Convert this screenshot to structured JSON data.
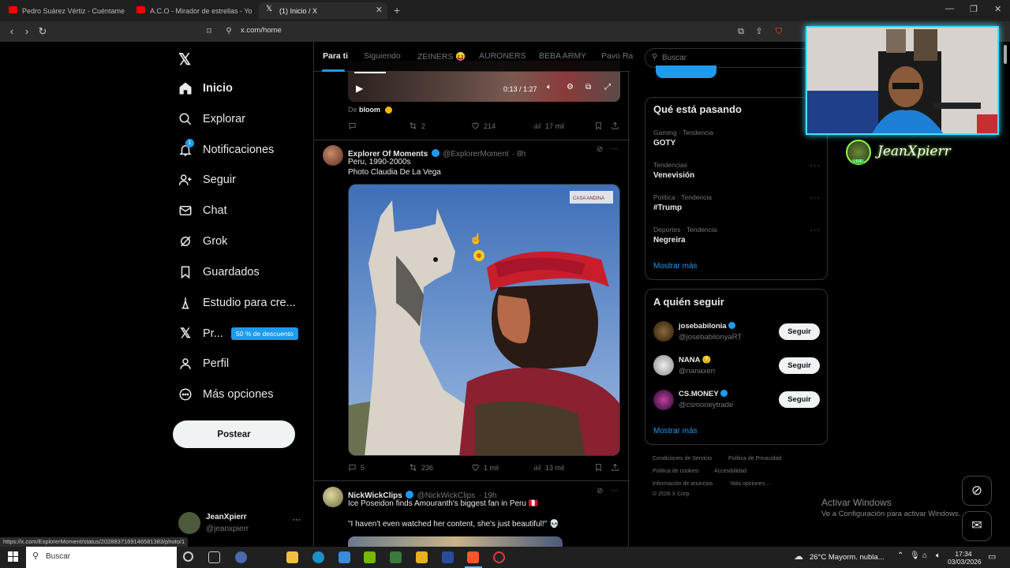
{
  "browser": {
    "tabs": [
      {
        "title": "Pedro Suárez Vértiz - Cuéntame - Yo",
        "favicon": "youtube-icon",
        "color": "#ff0000"
      },
      {
        "title": "A.C.O - Mirador de estrellas - Yo",
        "favicon": "youtube-icon",
        "color": "#ff0000"
      },
      {
        "title": "(1) Inicio / X",
        "favicon": "x-icon",
        "color": "#ffffff"
      }
    ],
    "url": "x.com/home",
    "status_url": "https://x.com/ExplorerMoment/status/2028837169146581383/photo/1"
  },
  "sidebar": {
    "items": [
      {
        "label": "Inicio",
        "icon": "home-icon"
      },
      {
        "label": "Explorar",
        "icon": "search-icon"
      },
      {
        "label": "Notificaciones",
        "icon": "bell-icon",
        "badge": "1"
      },
      {
        "label": "Seguir",
        "icon": "add-user-icon"
      },
      {
        "label": "Chat",
        "icon": "mail-icon"
      },
      {
        "label": "Grok",
        "icon": "grok-icon"
      },
      {
        "label": "Guardados",
        "icon": "bookmark-icon"
      },
      {
        "label": "Estudio para cre...",
        "icon": "studio-icon"
      },
      {
        "label": "Pr...",
        "icon": "x-premium-icon"
      },
      {
        "label": "Perfil",
        "icon": "person-icon"
      },
      {
        "label": "Más opciones",
        "icon": "more-circle-icon"
      }
    ],
    "promo_badge": "50 % de descuento",
    "post_button": "Postear",
    "account": {
      "name": "JeanXpierr",
      "handle": "@jeanxpierr"
    }
  },
  "feed": {
    "tabs": [
      "Para ti",
      "Siguiendo",
      "ZEINERS 😝",
      "AURONERS",
      "BEBA ARMY",
      "Pavo Ra"
    ],
    "tweet0": {
      "video_time": "0:13 / 1:27",
      "source_prefix": "De",
      "source_name": "bloom",
      "replies": "",
      "retweets": "2",
      "likes": "214",
      "views": "17 mil"
    },
    "tweet1": {
      "name": "Explorer Of Moments",
      "handle": "@ExplorerMoment",
      "time": "· 8h",
      "text_line1": "Peru, 1990-2000s",
      "text_line2": "Photo Claudia De La Vega",
      "watermark": "CASA ANDINA",
      "replies": "5",
      "retweets": "236",
      "likes": "1 mil",
      "views": "13 mil"
    },
    "tweet2": {
      "name": "NickWickClips",
      "handle": "@NickWickClips",
      "time": "· 19h",
      "text_line1": "Ice Poseidon finds Amouranth's biggest fan in Peru 🇵🇪",
      "text_line2": "\"I haven't even watched her content, she's just beautiful!\" 💀"
    }
  },
  "right": {
    "search_placeholder": "Buscar",
    "trends_title": "Qué está pasando",
    "trends": [
      {
        "category": "Gaming · Tendencia",
        "name": "GOTY"
      },
      {
        "category": "Tendencias",
        "name": "Venevisión"
      },
      {
        "category": "Política · Tendencia",
        "name": "#Trump"
      },
      {
        "category": "Deportes · Tendencia",
        "name": "Negreira"
      }
    ],
    "show_more": "Mostrar más",
    "follow_title": "A quién seguir",
    "follow": [
      {
        "name": "josebabilonia",
        "handle": "@josebabilonyaRT",
        "verified": true
      },
      {
        "name": "NANA 😔",
        "handle": "@nanaxeri",
        "verified": false
      },
      {
        "name": "CS.MONEY",
        "handle": "@csmoneytrade",
        "verified": true
      }
    ],
    "follow_button": "Seguir",
    "footer": [
      "Condiciones de Servicio",
      "Política de Privacidad",
      "Política de cookies",
      "Accesibilidad",
      "Información de anuncios",
      "Más opciones ···",
      "© 2026 X Corp."
    ]
  },
  "overlay": {
    "streamer": "JeanXpierr",
    "live": "LIVE",
    "activate_title": "Activar Windows",
    "activate_sub": "Ve a Configuración para activar Windows."
  },
  "taskbar": {
    "search": "Buscar",
    "weather": "26°C  Mayorm. nubla...",
    "time": "17:34",
    "date": "03/03/2026"
  },
  "colors": {
    "accent": "#1d9bf0",
    "background": "#000000",
    "border": "#2f3336",
    "muted": "#71767b"
  }
}
